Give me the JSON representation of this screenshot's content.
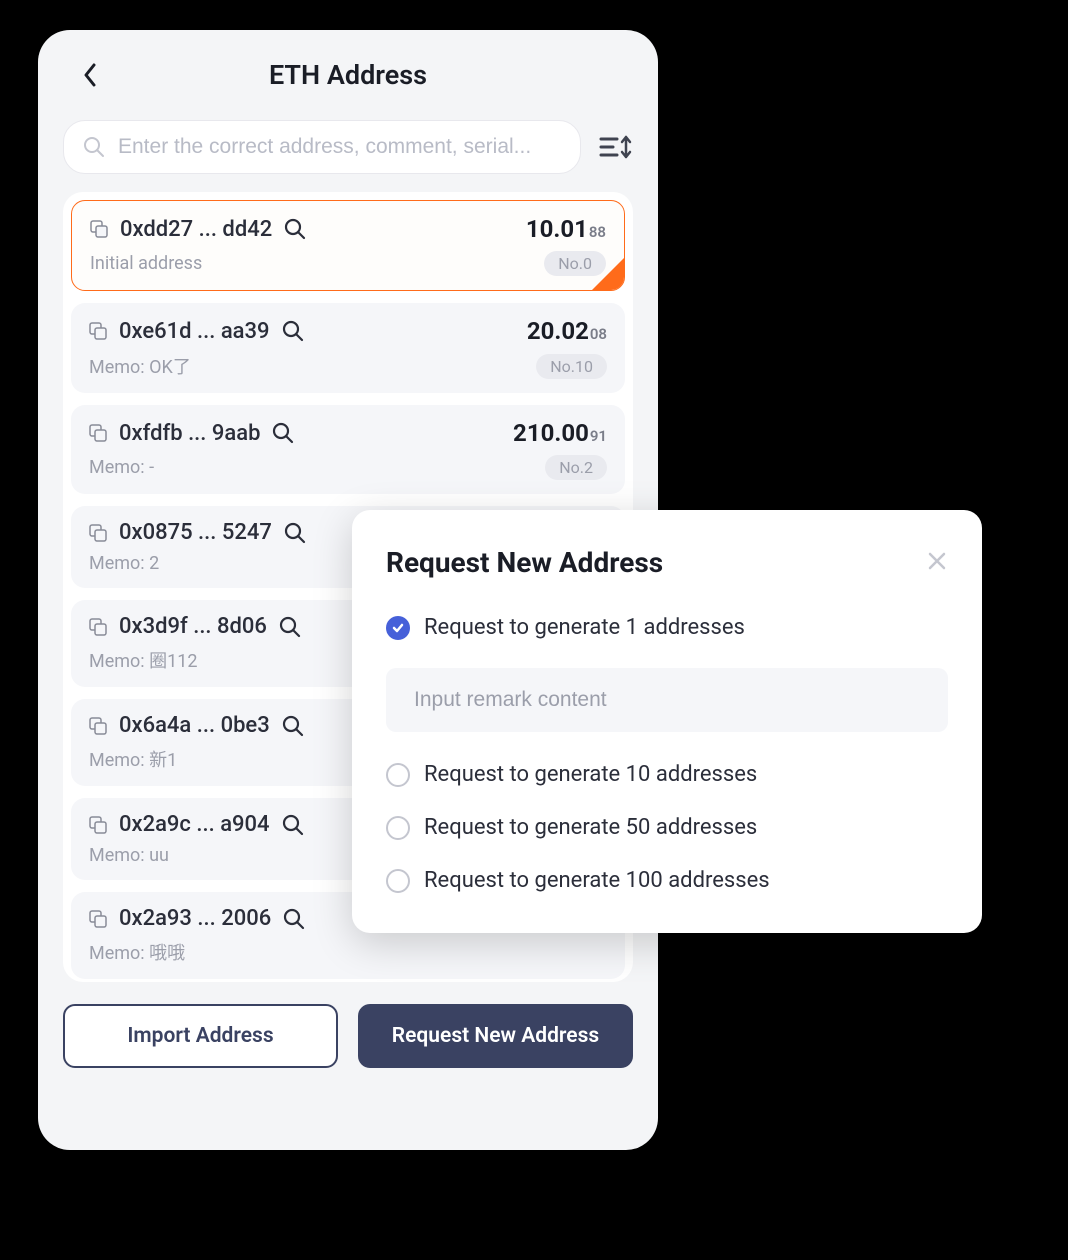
{
  "header": {
    "title": "ETH Address"
  },
  "search": {
    "placeholder": "Enter the correct address, comment, serial..."
  },
  "addresses": [
    {
      "address": "0xdd27 ... dd42",
      "balance_main": "10.01",
      "balance_dec": "88",
      "memo": "Initial address",
      "number": "No.0",
      "selected": true
    },
    {
      "address": "0xe61d ... aa39",
      "balance_main": "20.02",
      "balance_dec": "08",
      "memo": "Memo: OK了",
      "number": "No.10",
      "selected": false
    },
    {
      "address": "0xfdfb ... 9aab",
      "balance_main": "210.00",
      "balance_dec": "91",
      "memo": "Memo: -",
      "number": "No.2",
      "selected": false
    },
    {
      "address": "0x0875 ... 5247",
      "balance_main": "",
      "balance_dec": "",
      "memo": "Memo: 2",
      "number": "",
      "selected": false
    },
    {
      "address": "0x3d9f ... 8d06",
      "balance_main": "",
      "balance_dec": "",
      "memo": "Memo: 圈112",
      "number": "",
      "selected": false
    },
    {
      "address": "0x6a4a ... 0be3",
      "balance_main": "",
      "balance_dec": "",
      "memo": "Memo: 新1",
      "number": "",
      "selected": false
    },
    {
      "address": "0x2a9c ... a904",
      "balance_main": "",
      "balance_dec": "",
      "memo": "Memo: uu",
      "number": "",
      "selected": false
    },
    {
      "address": "0x2a93 ... 2006",
      "balance_main": "",
      "balance_dec": "",
      "memo": "Memo: 哦哦",
      "number": "",
      "selected": false
    }
  ],
  "buttons": {
    "import": "Import Address",
    "request": "Request New Address"
  },
  "modal": {
    "title": "Request New Address",
    "remark_placeholder": "Input remark content",
    "options": [
      {
        "label": "Request to generate 1 addresses",
        "checked": true
      },
      {
        "label": "Request to generate 10 addresses",
        "checked": false
      },
      {
        "label": "Request to generate 50 addresses",
        "checked": false
      },
      {
        "label": "Request to generate 100 addresses",
        "checked": false
      }
    ]
  }
}
